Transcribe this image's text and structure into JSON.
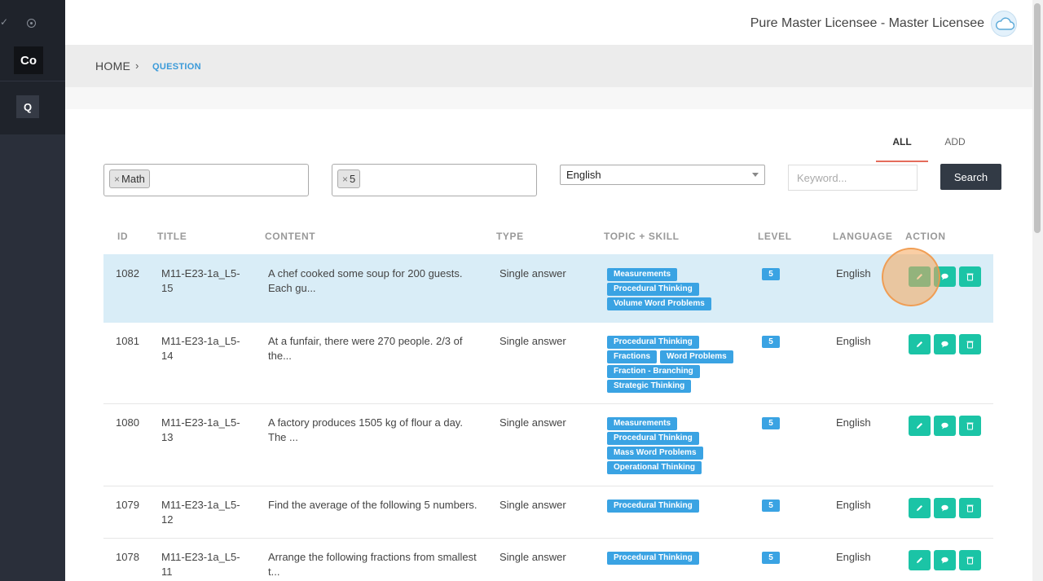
{
  "sidebar": {
    "co_label": "Co",
    "q_label": "Q",
    "check_glyph": "✓"
  },
  "header": {
    "user_name": "Pure Master Licensee - Master Licensee"
  },
  "breadcrumb": {
    "home": "HOME",
    "separator": "›",
    "current": "QUESTION"
  },
  "tabs": {
    "all": "ALL",
    "add": "ADD"
  },
  "filters": {
    "subject_chip": "Math",
    "level_chip": "5",
    "chip_remove": "×",
    "language_value": "English",
    "keyword_placeholder": "Keyword...",
    "search_label": "Search"
  },
  "table": {
    "headers": {
      "id": "ID",
      "title": "TITLE",
      "content": "CONTENT",
      "type": "TYPE",
      "topic": "TOPIC + SKILL",
      "level": "LEVEL",
      "language": "LANGUAGE",
      "action": "ACTION"
    },
    "rows": [
      {
        "id": "1082",
        "title": "M11-E23-1a_L5-15",
        "content": "A chef cooked some soup for 200 guests. Each gu...",
        "type": "Single answer",
        "tags": [
          [
            "Measurements"
          ],
          [
            "Procedural Thinking"
          ],
          [
            "Volume Word Problems"
          ]
        ],
        "level": "5",
        "language": "English"
      },
      {
        "id": "1081",
        "title": "M11-E23-1a_L5-14",
        "content": "At a funfair, there were 270 people. 2/3 of the...",
        "type": "Single answer",
        "tags": [
          [
            "Procedural Thinking"
          ],
          [
            "Fractions",
            "Word Problems"
          ],
          [
            "Fraction - Branching"
          ],
          [
            "Strategic Thinking"
          ]
        ],
        "level": "5",
        "language": "English"
      },
      {
        "id": "1080",
        "title": "M11-E23-1a_L5-13",
        "content": "A factory produces 1505 kg of flour a day. The ...",
        "type": "Single answer",
        "tags": [
          [
            "Measurements"
          ],
          [
            "Procedural Thinking"
          ],
          [
            "Mass Word Problems"
          ],
          [
            "Operational Thinking"
          ]
        ],
        "level": "5",
        "language": "English"
      },
      {
        "id": "1079",
        "title": "M11-E23-1a_L5-12",
        "content": "Find the average of the following 5 numbers.",
        "type": "Single answer",
        "tags": [
          [
            "Procedural Thinking"
          ]
        ],
        "level": "5",
        "language": "English"
      },
      {
        "id": "1078",
        "title": "M11-E23-1a_L5-11",
        "content": "Arrange the following fractions from smallest t...",
        "type": "Single answer",
        "tags": [
          [
            "Procedural Thinking"
          ]
        ],
        "level": "5",
        "language": "English"
      }
    ]
  },
  "colors": {
    "sidebar": "#2a2f3a",
    "tag": "#3aa3e3",
    "action": "#1bc4a6",
    "selected_row": "#d9edf7",
    "tab_underline": "#e46c5b",
    "search_button": "#323a45"
  },
  "icons": {
    "edit": "pencil-icon",
    "comment": "comment-icon",
    "delete": "trash-icon",
    "avatar": "cloud-icon"
  }
}
